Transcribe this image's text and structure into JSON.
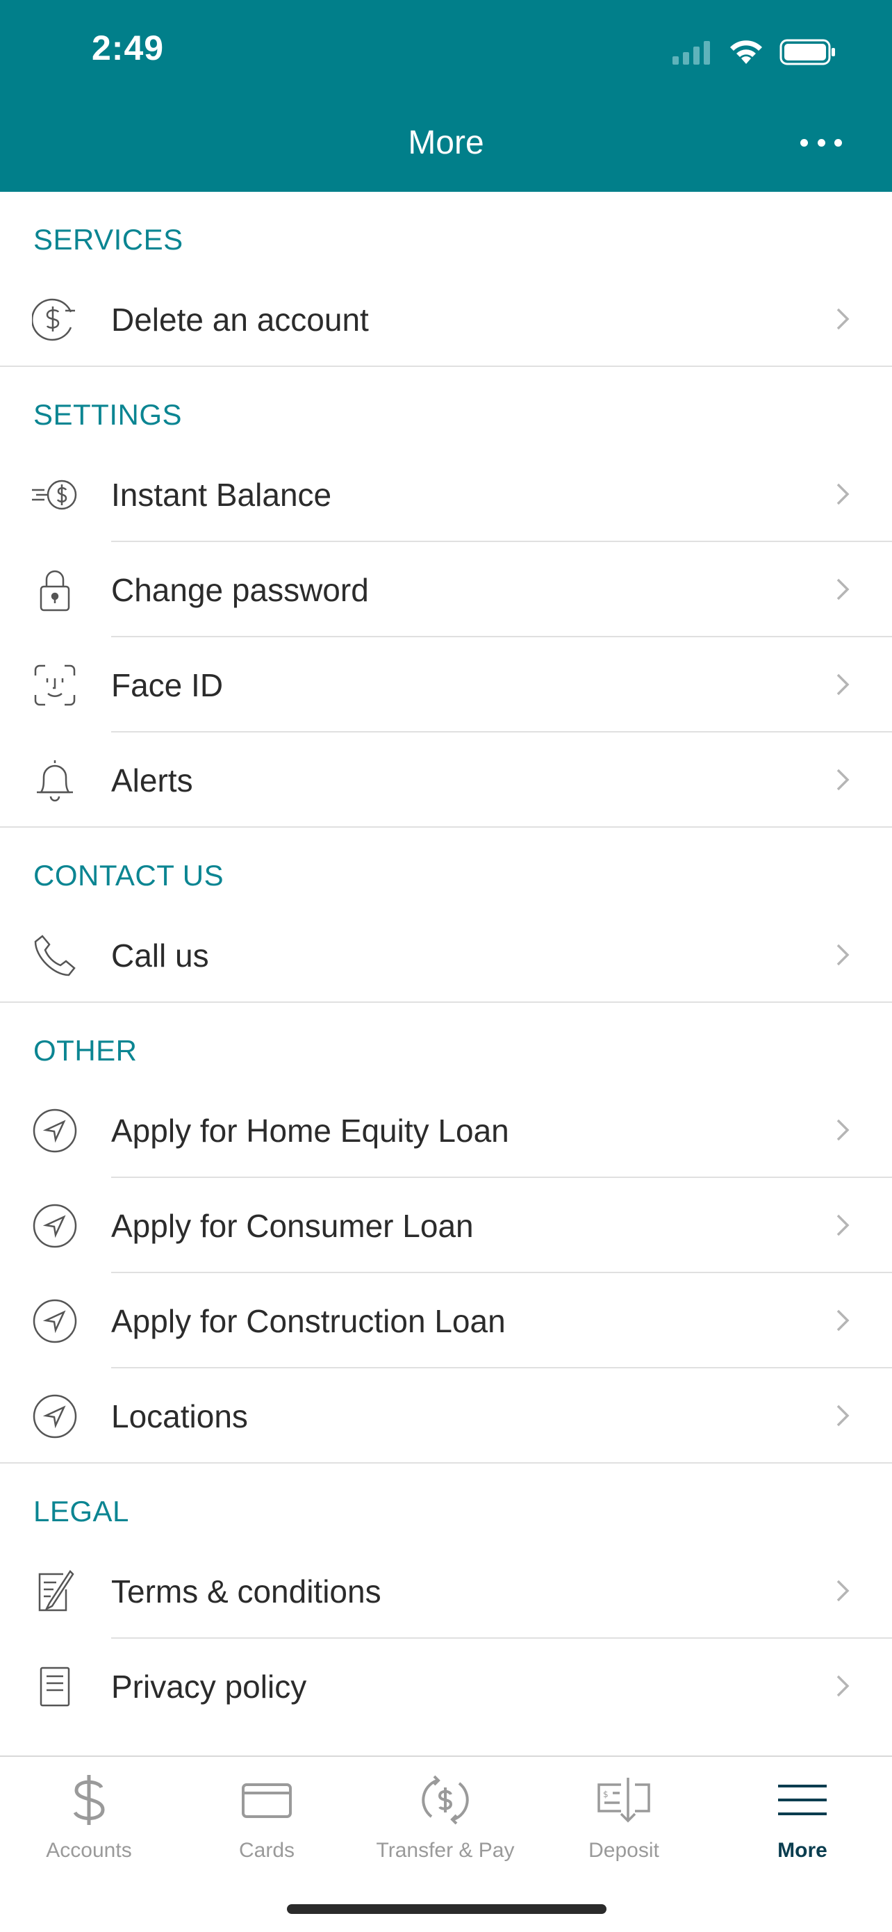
{
  "status_bar": {
    "time": "2:49"
  },
  "header": {
    "title": "More"
  },
  "sections": [
    {
      "title": "SERVICES",
      "items": [
        {
          "label": "Delete an account",
          "icon": "dollar-minus-icon"
        }
      ]
    },
    {
      "title": "SETTINGS",
      "items": [
        {
          "label": "Instant Balance",
          "icon": "instant-balance-icon"
        },
        {
          "label": "Change password",
          "icon": "lock-icon"
        },
        {
          "label": "Face ID",
          "icon": "face-id-icon"
        },
        {
          "label": "Alerts",
          "icon": "bell-icon"
        }
      ]
    },
    {
      "title": "CONTACT US",
      "items": [
        {
          "label": "Call us",
          "icon": "phone-icon"
        }
      ]
    },
    {
      "title": "OTHER",
      "items": [
        {
          "label": "Apply for Home Equity Loan",
          "icon": "navigation-arrow-icon"
        },
        {
          "label": "Apply for Consumer Loan",
          "icon": "navigation-arrow-icon"
        },
        {
          "label": "Apply for Construction Loan",
          "icon": "navigation-arrow-icon"
        },
        {
          "label": "Locations",
          "icon": "navigation-arrow-icon"
        }
      ]
    },
    {
      "title": "LEGAL",
      "items": [
        {
          "label": "Terms & conditions",
          "icon": "document-pen-icon"
        },
        {
          "label": "Privacy policy",
          "icon": "document-list-icon"
        }
      ]
    }
  ],
  "tabbar": {
    "tabs": [
      {
        "label": "Accounts",
        "icon": "dollar-icon"
      },
      {
        "label": "Cards",
        "icon": "card-icon"
      },
      {
        "label": "Transfer & Pay",
        "icon": "transfer-icon"
      },
      {
        "label": "Deposit",
        "icon": "check-deposit-icon"
      },
      {
        "label": "More",
        "icon": "menu-icon",
        "active": true
      }
    ]
  },
  "colors": {
    "header": "#017f8a",
    "section_title": "#0b8592",
    "active_tab": "#0a3d4f",
    "inactive_tab": "#9a9a9a"
  }
}
